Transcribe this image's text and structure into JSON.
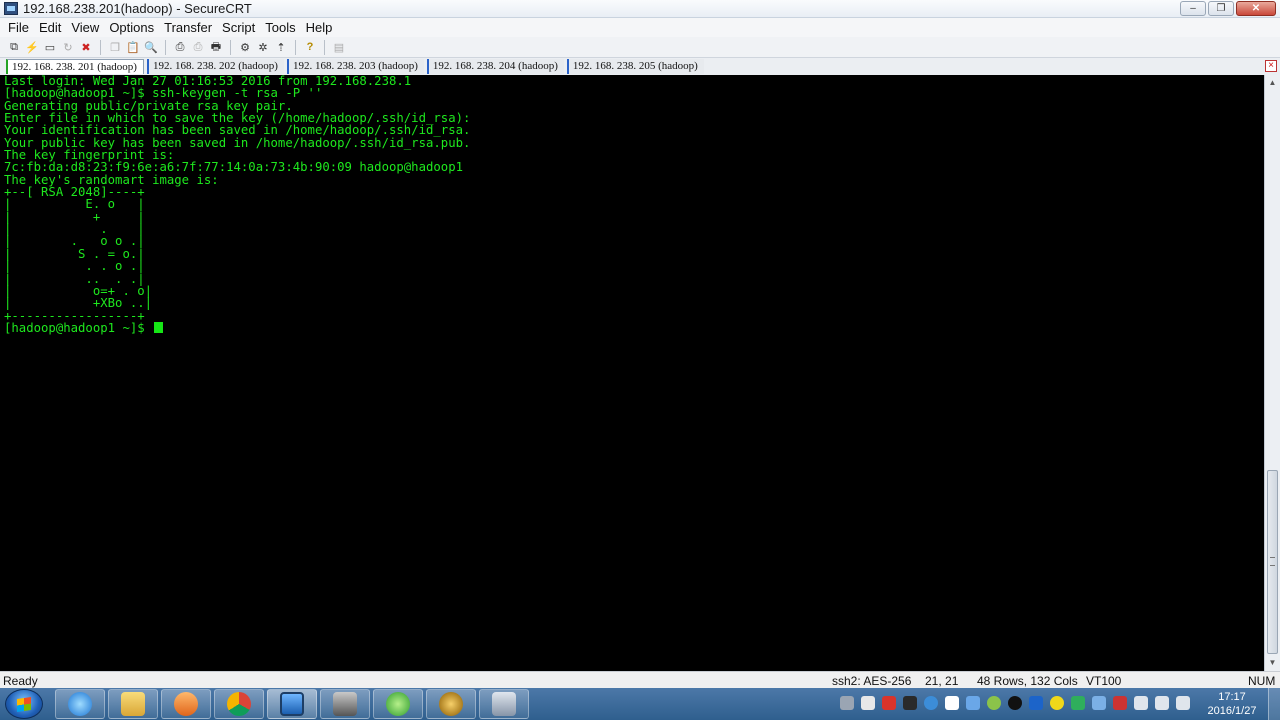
{
  "window": {
    "title": "192.168.238.201(hadoop) - SecureCRT",
    "min": "–",
    "max": "❐",
    "close": "✕"
  },
  "menu": [
    "File",
    "Edit",
    "View",
    "Options",
    "Transfer",
    "Script",
    "Tools",
    "Help"
  ],
  "toolbar_icons": [
    "connect-icon",
    "quick-connect-icon",
    "connect-in-tab-icon",
    "reconnect-icon",
    "disconnect-icon",
    "copy-icon",
    "paste-icon",
    "find-icon",
    "print-icon",
    "print-selection-icon",
    "print-setup-icon",
    "session-options-icon",
    "global-options-icon",
    "keymap-icon",
    "help-icon",
    "sftp-icon"
  ],
  "tabs": [
    {
      "label": "192. 168. 238. 201 (hadoop)",
      "active": true
    },
    {
      "label": "192. 168. 238. 202 (hadoop)",
      "active": false
    },
    {
      "label": "192. 168. 238. 203 (hadoop)",
      "active": false
    },
    {
      "label": "192. 168. 238. 204 (hadoop)",
      "active": false
    },
    {
      "label": "192. 168. 238. 205 (hadoop)",
      "active": false
    }
  ],
  "tab_close": "×",
  "terminal": {
    "lines": [
      "Last login: Wed Jan 27 01:16:53 2016 from 192.168.238.1",
      "[hadoop@hadoop1 ~]$ ssh-keygen -t rsa -P ''",
      "Generating public/private rsa key pair.",
      "Enter file in which to save the key (/home/hadoop/.ssh/id_rsa):",
      "Your identification has been saved in /home/hadoop/.ssh/id_rsa.",
      "Your public key has been saved in /home/hadoop/.ssh/id_rsa.pub.",
      "The key fingerprint is:",
      "7c:fb:da:d8:23:f9:6e:a6:7f:77:14:0a:73:4b:90:09 hadoop@hadoop1",
      "The key's randomart image is:",
      "+--[ RSA 2048]----+",
      "|          E. o   |",
      "|           +     |",
      "|            .    |",
      "|        .   o o .|",
      "|         S . = o.|",
      "|          . . o .|",
      "|          ..  . .|",
      "|           o=+ . o|",
      "|           +XBo ..|",
      "+-----------------+"
    ],
    "prompt": "[hadoop@hadoop1 ~]$ "
  },
  "status": {
    "ready": "Ready",
    "cipher": "ssh2: AES-256",
    "position": "21,  21",
    "size": "48 Rows, 132 Cols",
    "emulation": "VT100",
    "num": "NUM"
  },
  "taskbar": {
    "apps": [
      "internet-explorer-icon",
      "file-explorer-icon",
      "media-player-icon",
      "chrome-icon",
      "securecrt-icon",
      "vpn-lock-icon",
      "green-app-icon",
      "e-app-icon",
      "window-app-icon"
    ],
    "clock_time": "17:17",
    "clock_date": "2016/1/27"
  }
}
